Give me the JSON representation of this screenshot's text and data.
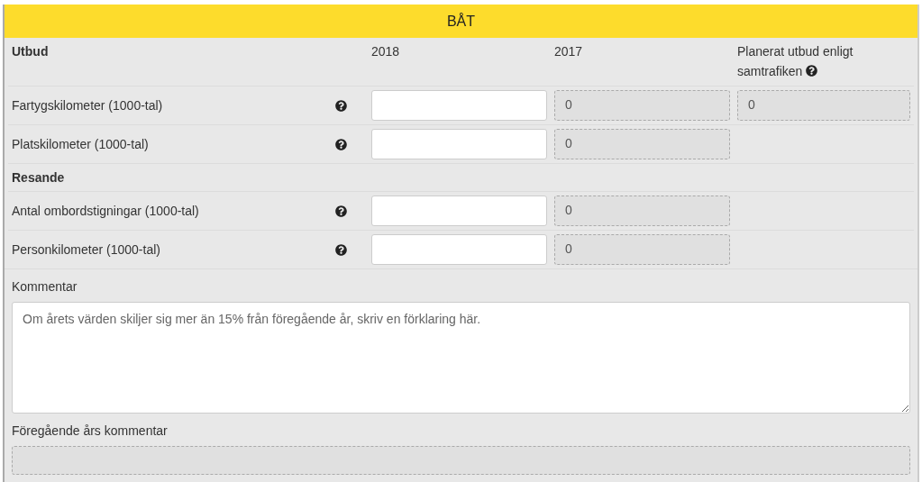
{
  "title": "BÅT",
  "header": {
    "label": "Utbud",
    "columns": [
      "2018",
      "2017",
      "Planerat utbud enligt samtrafiken"
    ]
  },
  "rows": [
    {
      "kind": "metric",
      "label": "Fartygskilometer (1000-tal)",
      "previous": "0",
      "planned": "0"
    },
    {
      "kind": "metric",
      "label": "Platskilometer (1000-tal)",
      "previous": "0"
    },
    {
      "kind": "section",
      "label": "Resande"
    },
    {
      "kind": "metric",
      "label": "Antal ombordstigningar (1000-tal)",
      "previous": "0"
    },
    {
      "kind": "metric",
      "label": "Personkilometer (1000-tal)",
      "previous": "0"
    }
  ],
  "comment": {
    "label": "Kommentar",
    "placeholder": "Om årets värden skiljer sig mer än 15% från föregående år, skriv en förklaring här."
  },
  "previous_comment": {
    "label": "Föregående års kommentar"
  }
}
